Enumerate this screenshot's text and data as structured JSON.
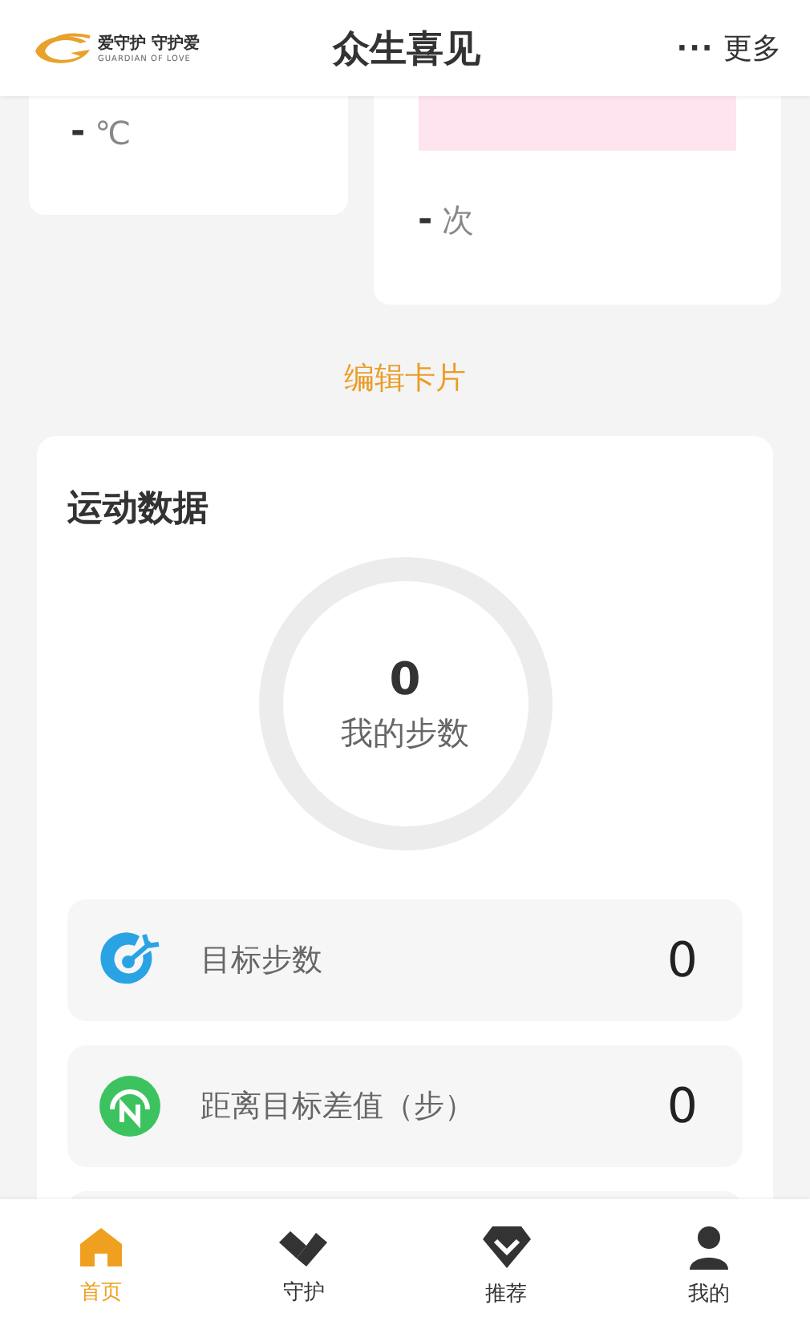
{
  "header": {
    "logo_text": "爱守护 守护爱",
    "logo_subtext": "GUARDIAN OF LOVE",
    "title": "众生喜见",
    "more_icon": "···",
    "more": "更多"
  },
  "top_cards": [
    {
      "value": "-",
      "unit": "℃",
      "kind": "plain"
    },
    {
      "value": "-",
      "unit": "次",
      "kind": "chart"
    }
  ],
  "edit_link": "编辑卡片",
  "sport": {
    "title": "运动数据",
    "ring": {
      "value": "0",
      "label": "我的步数"
    },
    "rows": [
      {
        "kind": "target",
        "label": "目标步数",
        "value": "0"
      },
      {
        "kind": "north",
        "label": "距离目标差值（步）",
        "value": "0"
      }
    ]
  },
  "tabs": [
    {
      "kind": "home",
      "label": "首页",
      "selected": true
    },
    {
      "kind": "guard",
      "label": "守护",
      "selected": false
    },
    {
      "kind": "diamond",
      "label": "推荐",
      "selected": false
    },
    {
      "kind": "user",
      "label": "我的",
      "selected": false
    }
  ]
}
